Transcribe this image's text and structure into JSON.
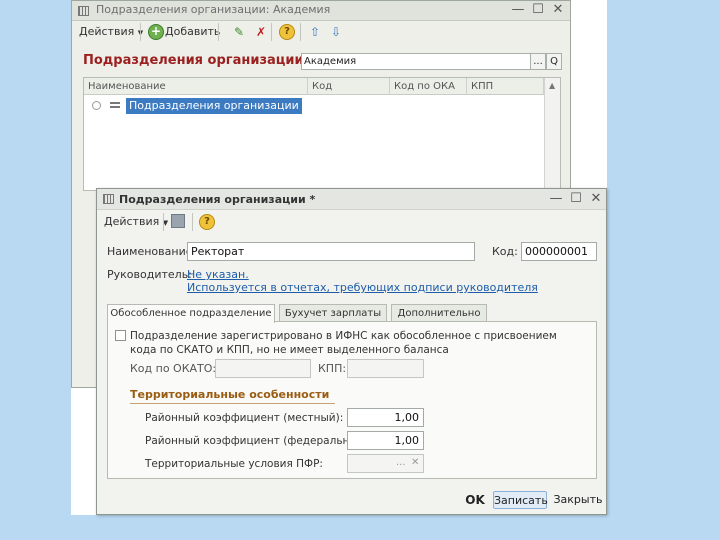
{
  "main_window": {
    "title": "Подразделения организации: Академия",
    "toolbar": {
      "actions_label": "Действия",
      "add_label": "Добавить"
    },
    "heading": "Подразделения организации",
    "org_field": {
      "value": "Академия",
      "select_btn": "...",
      "search_btn": "Q"
    },
    "table": {
      "columns": [
        "Наименование",
        "Код",
        "Код по ОКА",
        "КПП"
      ],
      "rows": [
        {
          "name": "Подразделения организации"
        }
      ]
    }
  },
  "dialog": {
    "title": "Подразделения организации *",
    "toolbar": {
      "actions_label": "Действия"
    },
    "name_label": "Наименование:",
    "name_value": "Ректорат",
    "code_label": "Код:",
    "code_value": "000000001",
    "head_label": "Руководитель:",
    "head_link": "Не указан.",
    "head_hint": "Используется в отчетах, требующих подписи руководителя",
    "tabs": [
      "Обособленное подразделение",
      "Бухучет зарплаты",
      "Дополнительно"
    ],
    "active_tab": 0,
    "separate": {
      "checkbox_label": "Подразделение зарегистрировано в ИФНС как обособленное с присвоением кода по СКАТО и КПП, но не имеет выделенного баланса",
      "checkbox_checked": false,
      "okato_label": "Код по ОКАТО:",
      "okato_value": "",
      "kpp_label": "КПП:",
      "kpp_value": "",
      "section_title": "Территориальные особенности",
      "local_coef_label": "Районный коэффициент (местный):",
      "local_coef_value": "1,00",
      "federal_coef_label": "Районный коэффициент (федеральный):",
      "federal_coef_value": "1,00",
      "pfr_label": "Территориальные условия ПФР:",
      "pfr_value": "",
      "pfr_select_btn": "...",
      "pfr_clear_btn": "✕"
    },
    "footer": {
      "ok": "OK",
      "save": "Записать",
      "close": "Закрыть"
    }
  },
  "colors": {
    "accent_heading": "#9b2020",
    "section_heading": "#9a5c12",
    "link": "#1d5ca8",
    "selection": "#3c7bc2"
  }
}
